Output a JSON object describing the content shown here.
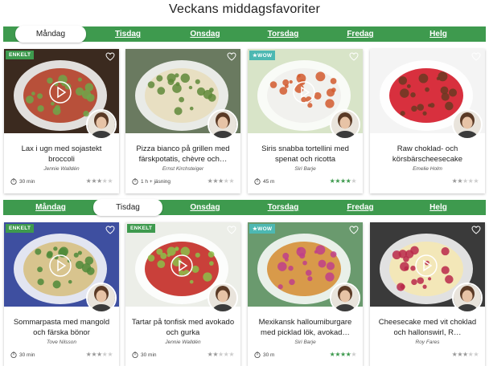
{
  "page_title": "Veckans middagsfavoriter",
  "sections": [
    {
      "tabs": [
        "Måndag",
        "Tisdag",
        "Onsdag",
        "Torsdag",
        "Fredag",
        "Helg"
      ],
      "active_tab": "Måndag",
      "cards": [
        {
          "badge": "ENKELT",
          "title": "Lax i ugn med sojastekt broccoli",
          "author": "Jennie Walldén",
          "time": "30 min",
          "rating": 3,
          "has_video": true,
          "colors": {
            "bg": "#3b2a1f",
            "food": "#b8503a",
            "accent": "#6fa64a"
          }
        },
        {
          "badge": "",
          "title": "Pizza bianco på grillen med färskpotatis, chèvre och…",
          "author": "Ernst Kirchsteiger",
          "time": "1 h + jäsning",
          "rating": 3,
          "has_video": false,
          "colors": {
            "bg": "#6a7a60",
            "food": "#e8dfc2",
            "accent": "#5f8a3a"
          }
        },
        {
          "badge": "WOW",
          "title": "Siris snabba tortellini med spenat och ricotta",
          "author": "Siri Barje",
          "time": "45 m",
          "rating": 4,
          "has_video": true,
          "colors": {
            "bg": "#d8e4c8",
            "food": "#f1f1ee",
            "accent": "#d25a2e"
          }
        },
        {
          "badge": "",
          "title": "Raw choklad- och körsbärscheesecake",
          "author": "Emelie Holm",
          "time": "",
          "rating": 2,
          "has_video": false,
          "colors": {
            "bg": "#f4f4f4",
            "food": "#d8303e",
            "accent": "#6b3a22"
          }
        }
      ]
    },
    {
      "tabs": [
        "Måndag",
        "Tisdag",
        "Onsdag",
        "Torsdag",
        "Fredag",
        "Helg"
      ],
      "active_tab": "Tisdag",
      "cards": [
        {
          "badge": "ENKELT",
          "title": "Sommarpasta med mangold och färska bönor",
          "author": "Tove Nilsson",
          "time": "30 min",
          "rating": 3,
          "has_video": true,
          "colors": {
            "bg": "#3e4fa0",
            "food": "#d8c48e",
            "accent": "#4f8a3a"
          }
        },
        {
          "badge": "ENKELT",
          "title": "Tartar på tonfisk med avokado och gurka",
          "author": "Jennie Walldén",
          "time": "30 min",
          "rating": 2,
          "has_video": true,
          "colors": {
            "bg": "#eceee8",
            "food": "#c9403a",
            "accent": "#8cbf4a"
          }
        },
        {
          "badge": "WOW",
          "title": "Mexikansk halloumiburgare med picklad lök, avokad…",
          "author": "Siri Barje",
          "time": "30 m",
          "rating": 4,
          "has_video": false,
          "colors": {
            "bg": "#6a9a6e",
            "food": "#d89a4a",
            "accent": "#c0408a"
          }
        },
        {
          "badge": "",
          "title": "Cheesecake med vit choklad och hallonswirl, R…",
          "author": "Roy Fares",
          "time": "",
          "rating": 3,
          "has_video": true,
          "colors": {
            "bg": "#3a3a3a",
            "food": "#f3e7b8",
            "accent": "#b8284a"
          }
        }
      ]
    }
  ]
}
